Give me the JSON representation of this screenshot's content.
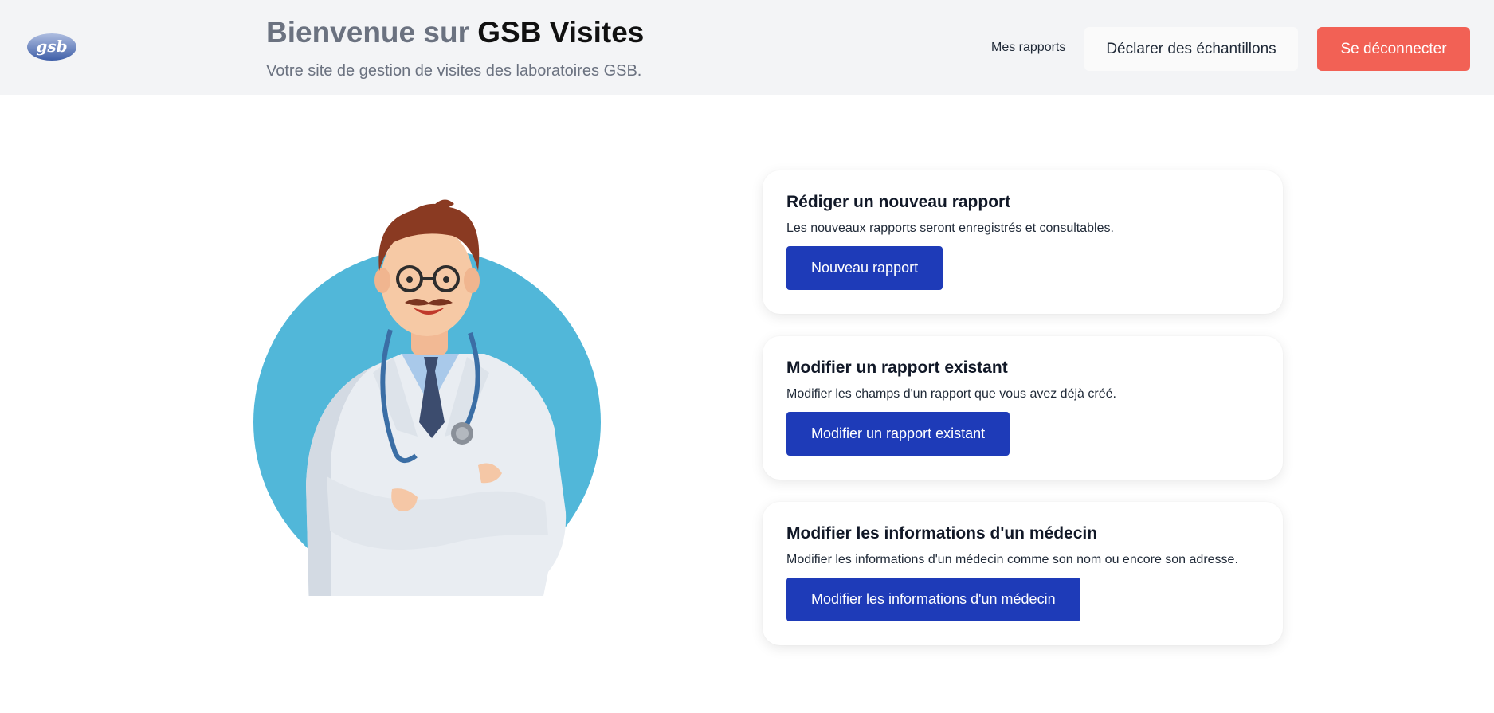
{
  "header": {
    "logo_text": "gsb",
    "title_prefix": "Bienvenue sur ",
    "title_brand": "GSB Visites",
    "subtitle": "Votre site de gestion de visites des laboratoires GSB.",
    "nav_reports": "Mes rapports",
    "declare_samples": "Déclarer des échantillons",
    "logout": "Se déconnecter"
  },
  "cards": [
    {
      "title": "Rédiger un nouveau rapport",
      "text": "Les nouveaux rapports seront enregistrés et consultables.",
      "button": "Nouveau rapport"
    },
    {
      "title": "Modifier un rapport existant",
      "text": "Modifier les champs d'un rapport que vous avez déjà créé.",
      "button": "Modifier un rapport existant"
    },
    {
      "title": "Modifier les informations d'un médecin",
      "text": "Modifier les informations d'un médecin comme son nom ou encore son adresse.",
      "button": "Modifier les informations d'un médecin"
    }
  ],
  "colors": {
    "header_bg": "#f3f4f6",
    "primary": "#1e3bb8",
    "danger": "#f26155",
    "circle": "#51b7d9"
  },
  "illustration": "doctor-illustration"
}
